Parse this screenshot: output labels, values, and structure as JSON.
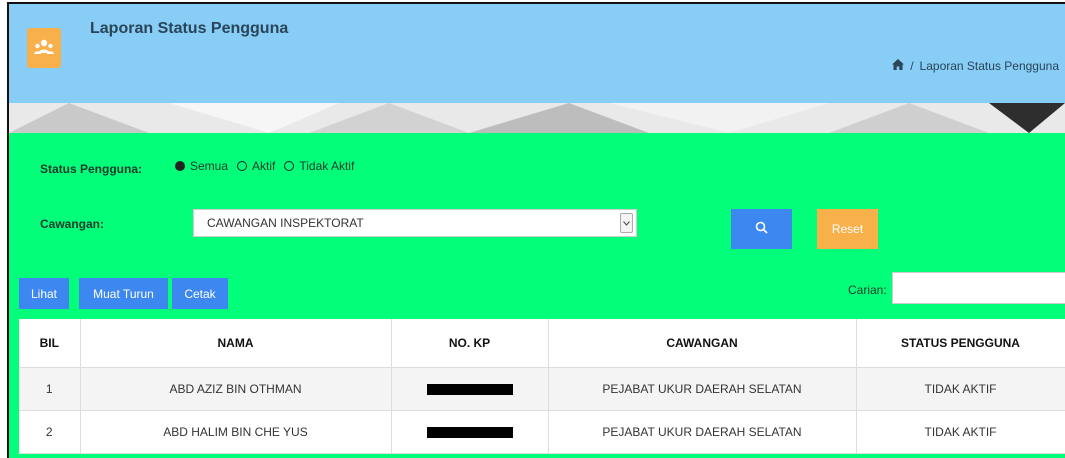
{
  "header": {
    "title": "Laporan Status Pengguna",
    "breadcrumb": {
      "separator": "/",
      "current": "Laporan Status Pengguna"
    }
  },
  "filters": {
    "status_label": "Status Pengguna:",
    "status_options": [
      {
        "label": "Semua",
        "selected": true
      },
      {
        "label": "Aktif",
        "selected": false
      },
      {
        "label": "Tidak Aktif",
        "selected": false
      }
    ],
    "branch_label": "Cawangan:",
    "branch_value": "CAWANGAN INSPEKTORAT",
    "reset_label": "Reset"
  },
  "toolbar": {
    "view_label": "Lihat",
    "download_label": "Muat Turun",
    "print_label": "Cetak",
    "search_label": "Carian:",
    "search_value": ""
  },
  "table": {
    "headers": [
      "BIL",
      "NAMA",
      "NO. KP",
      "CAWANGAN",
      "STATUS PENGGUNA"
    ],
    "rows": [
      {
        "bil": "1",
        "nama": "ABD AZIZ BIN OTHMAN",
        "no_kp": "",
        "cawangan": "PEJABAT UKUR DAERAH SELATAN",
        "status": "TIDAK AKTIF"
      },
      {
        "bil": "2",
        "nama": "ABD HALIM BIN CHE YUS",
        "no_kp": "",
        "cawangan": "PEJABAT UKUR DAERAH SELATAN",
        "status": "TIDAK AKTIF"
      }
    ]
  },
  "colors": {
    "header_bg": "#87cdf5",
    "panel_bg": "#03ff7a",
    "primary_button": "#3d88f0",
    "reset_button": "#f8b04a",
    "status_inactive": "#ff0000"
  },
  "icons": {
    "app": "users-icon",
    "breadcrumb_home": "home-icon",
    "search_button": "search-icon",
    "select": "chevron-down-icon"
  }
}
